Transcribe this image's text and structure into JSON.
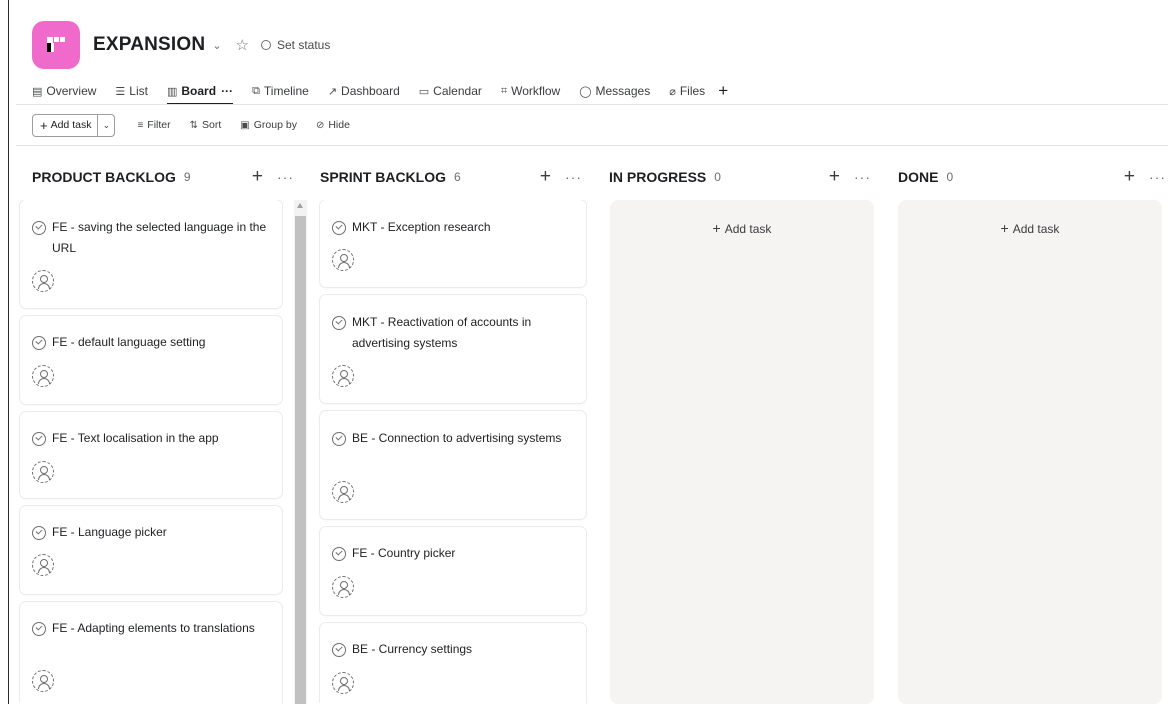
{
  "project": {
    "name": "EXPANSION",
    "logo_color": "#f06acb",
    "status_label": "Set status"
  },
  "tabs": [
    {
      "label": "Overview",
      "icon": "document-icon"
    },
    {
      "label": "List",
      "icon": "list-icon"
    },
    {
      "label": "Board",
      "icon": "board-icon",
      "active": true
    },
    {
      "label": "Timeline",
      "icon": "timeline-icon"
    },
    {
      "label": "Dashboard",
      "icon": "chart-icon"
    },
    {
      "label": "Calendar",
      "icon": "calendar-icon"
    },
    {
      "label": "Workflow",
      "icon": "workflow-icon"
    },
    {
      "label": "Messages",
      "icon": "message-icon"
    },
    {
      "label": "Files",
      "icon": "paperclip-icon"
    }
  ],
  "tab_more": "···",
  "tab_add": "+",
  "toolbar": {
    "add_task": "Add task",
    "filter": "Filter",
    "sort": "Sort",
    "group_by": "Group by",
    "hide": "Hide"
  },
  "columns": [
    {
      "title": "PRODUCT BACKLOG",
      "count": "9",
      "tasks": [
        "FE - saving the selected language in the URL",
        "FE - default language setting",
        "FE - Text localisation in the app",
        "FE - Language picker",
        "FE - Adapting elements to translations"
      ]
    },
    {
      "title": "SPRINT BACKLOG",
      "count": "6",
      "tasks": [
        "MKT - Exception research",
        "MKT - Reactivation of accounts in advertising systems",
        "BE - Connection to advertising systems",
        "FE - Country picker",
        "BE - Currency settings"
      ]
    },
    {
      "title": "IN PROGRESS",
      "count": "0",
      "add_label": "Add task"
    },
    {
      "title": "DONE",
      "count": "0",
      "add_label": "Add task"
    }
  ],
  "colors": {
    "lane_background": "#f5f4f3",
    "text": "#1e1f21",
    "muted": "#6d6e6f"
  }
}
